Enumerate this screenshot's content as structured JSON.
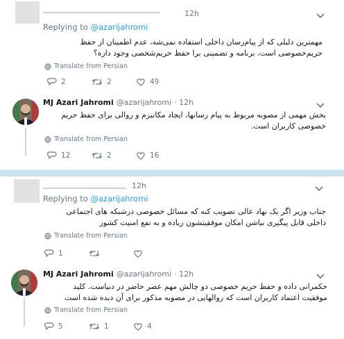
{
  "tweets": [
    {
      "time": "12h",
      "reply_label": "Replying to ",
      "reply_handle": "@azarijahromi",
      "text": [
        "مهمترین دلیلی که از پیام‌رسان داخلی استفاده نمی‌شه، عدم اطمینان از حفظ",
        "حریم‌خصوصی است، برنامه و تضمینی برا حفظ حریم‌شخصی وجود داره؟"
      ],
      "translate": "Translate from Persian",
      "replies": "2",
      "retweets": "2",
      "likes": "49"
    },
    {
      "name": "MJ Azari Jahromi",
      "handle": "@azarijahromi",
      "time": "· 12h",
      "text": [
        "بخش مهمی از مصوبه مربوط به پیام رسانها، ایجاد مکانیزم و روالی برای حفظ حریم",
        "خصوصی کاربران است."
      ],
      "translate": "Translate from Persian",
      "replies": "12",
      "retweets": "2",
      "likes": "16"
    },
    {
      "time": "12h",
      "reply_label": "Replying to ",
      "reply_handle": "@azarijahromi",
      "text": [
        "جناب وزیر اگر یک نهاد عالی تصویب کنه که مسائل خصوصی درشبکه های اجتماعی",
        "داخلی قابل پیگیری نباشن امکان موفقیتشون زیاده و به نفع امنیت کشور"
      ],
      "translate": "Translate from Persian",
      "replies": "1",
      "retweets": "",
      "likes": ""
    },
    {
      "name": "MJ Azari Jahromi",
      "handle": "@azarijahromi",
      "time": "· 12h",
      "text": [
        "حکمرانی داده و حفظ حریم خصوصی دو چالش مهم عصر حاضر در دنیاست. کلید",
        "موفقیت اعتماد کاربران است که روالهایی در مصوبه مذکور برای آن دیده شده است"
      ],
      "translate": "Translate from Persian",
      "replies": "5",
      "retweets": "1",
      "likes": "4"
    }
  ],
  "icons": {
    "reply": "reply-icon",
    "retweet": "retweet-icon",
    "like": "like-icon",
    "globe": "globe-icon",
    "chevron": "chevron-down-icon"
  },
  "colors": {
    "link": "#1da1f2",
    "muted": "#657786",
    "separator": "#c9e1ef",
    "background": "#e6ecf0"
  }
}
